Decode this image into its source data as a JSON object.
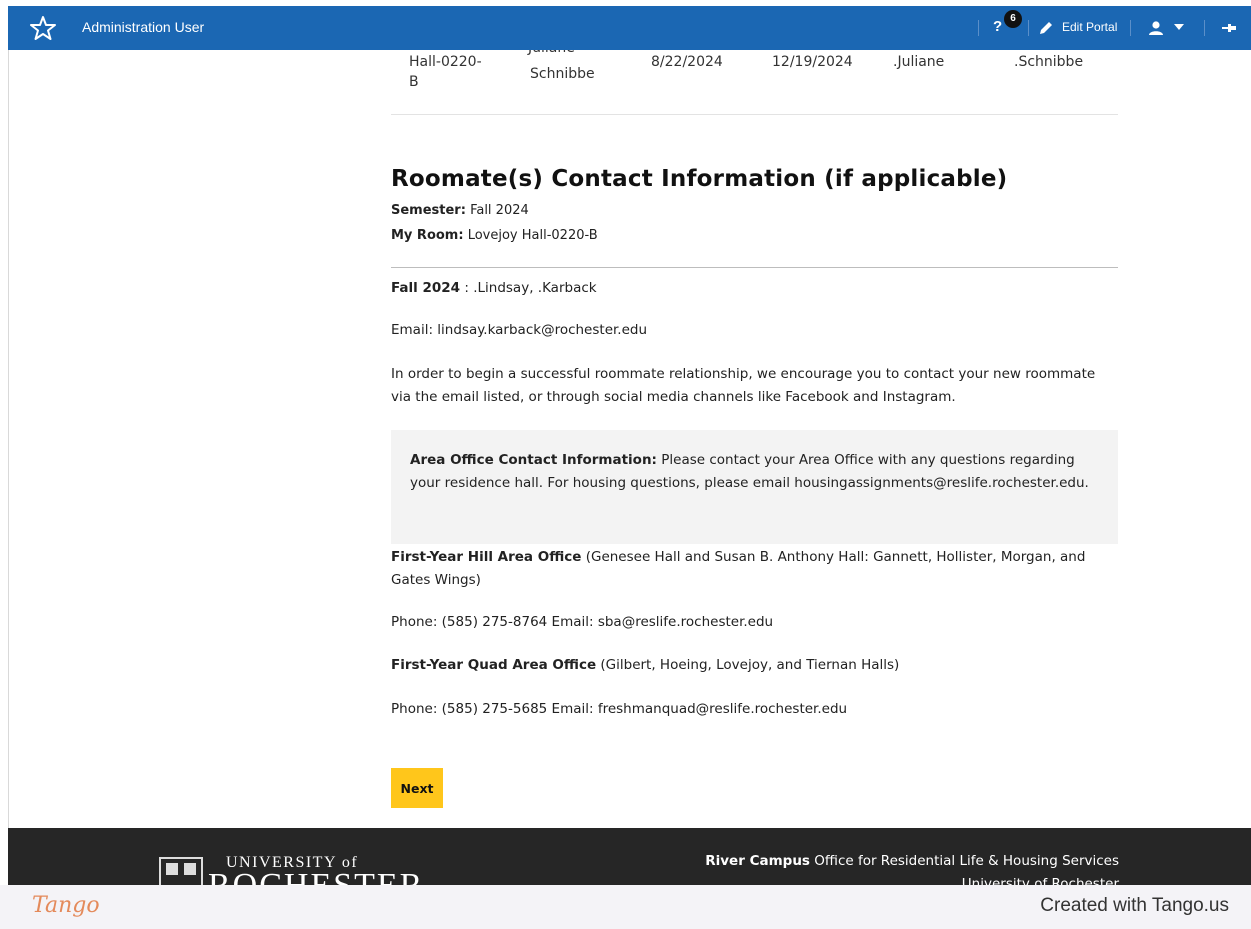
{
  "topbar": {
    "title": "Administration User",
    "help_label": "?",
    "help_badge": "6",
    "edit_portal_label": "Edit Portal",
    "color": "#1b67b3"
  },
  "prev_table_row": {
    "cutoff_text": "Juliane",
    "cells": [
      "Hall-0220-\nB",
      "Schnibbe",
      "8/22/2024",
      "12/19/2024",
      ".Juliane",
      ".Schnibbe"
    ]
  },
  "roommate": {
    "title": "Roomate(s) Contact Information (if applicable)",
    "semester_label": "Semester:",
    "semester_value": "Fall 2024",
    "room_label": "My Room:",
    "room_value": "Lovejoy Hall-0220-B",
    "entry_term": "Fall 2024",
    "entry_names": " : .Lindsay, .Karback",
    "email_line": "Email: lindsay.karback@rochester.edu",
    "encouragement": "In order to begin a successful roommate relationship, we encourage you to contact your new roommate via the email listed, or through social media channels like Facebook and Instagram."
  },
  "area_office": {
    "heading": "Area Office Contact Information:",
    "text": " Please contact your Area Office with any questions regarding your residence hall. For housing questions, please email housingassignments@reslife.rochester.edu.",
    "hill_name": "First-Year Hill Area Office",
    "hill_desc": " (Genesee Hall and Susan B. Anthony Hall: Gannett, Hollister, Morgan, and Gates Wings)",
    "hill_phone": "Phone: (585) 275-8764 Email: sba@reslife.rochester.edu",
    "quad_name": "First-Year Quad Area Office",
    "quad_desc": " (Gilbert, Hoeing, Lovejoy, and Tiernan Halls)",
    "quad_phone": "Phone: (585) 275-5685 Email: freshmanquad@reslife.rochester.edu"
  },
  "next_button": {
    "label": "Next",
    "color": "#ffc61b"
  },
  "footer": {
    "logo_top": "UNIVERSITY of",
    "logo_bottom": "ROCHESTER",
    "campus_bold": "River Campus",
    "campus_rest": " Office for Residential Life & Housing Services",
    "university_line": "University of Rochester"
  },
  "tango": {
    "brand": "Tango",
    "credit": "Created with Tango.us"
  }
}
